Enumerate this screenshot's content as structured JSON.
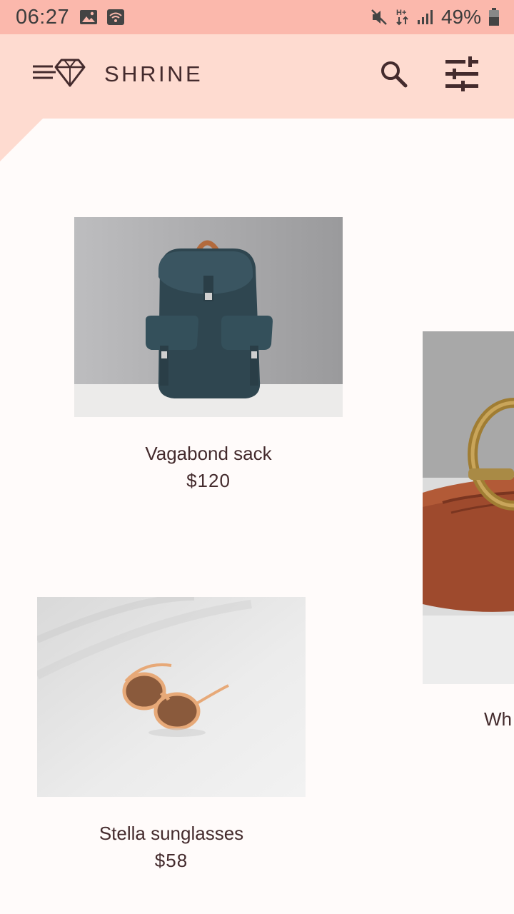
{
  "status_bar": {
    "time": "06:27",
    "battery_percent": "49%",
    "left_icons": [
      "image-icon",
      "wifi-icon"
    ],
    "right_icons": [
      "mute-icon",
      "hplus-data-icon",
      "signal-icon",
      "battery-icon"
    ]
  },
  "app_bar": {
    "title": "SHRINE",
    "icons": [
      "menu-diamond-icon",
      "search-icon",
      "tune-icon"
    ]
  },
  "products": [
    {
      "name": "Vagabond sack",
      "price": "$120",
      "image": "backpack"
    },
    {
      "name": "Wh",
      "price": "",
      "image": "belt"
    },
    {
      "name": "Stella sunglasses",
      "price": "$58",
      "image": "sunglasses"
    }
  ],
  "colors": {
    "status_bar": "#fbb8ac",
    "app_bar": "#fedbd0",
    "surface": "#fffbfa",
    "text": "#442b2d"
  }
}
